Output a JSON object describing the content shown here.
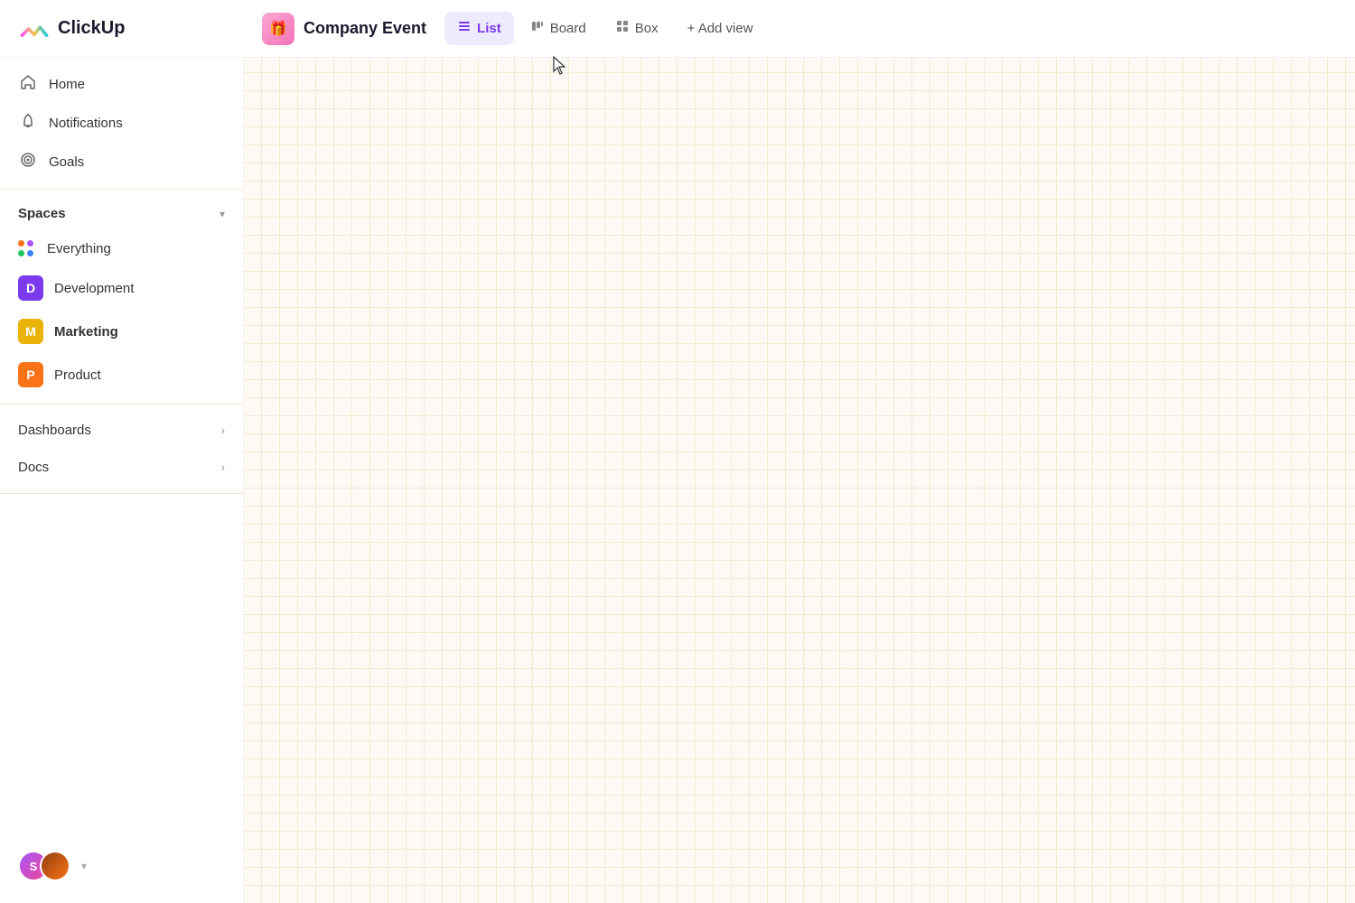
{
  "logo": {
    "text": "ClickUp"
  },
  "header": {
    "space_icon": "🎁",
    "space_name": "Company Event",
    "views": [
      {
        "id": "list",
        "label": "List",
        "icon": "≡",
        "active": true
      },
      {
        "id": "board",
        "label": "Board",
        "icon": "▦",
        "active": false
      },
      {
        "id": "box",
        "label": "Box",
        "icon": "⊞",
        "active": false
      }
    ],
    "add_view_label": "+ Add view"
  },
  "sidebar": {
    "nav_items": [
      {
        "id": "home",
        "label": "Home",
        "icon": "⌂"
      },
      {
        "id": "notifications",
        "label": "Notifications",
        "icon": "🔔"
      },
      {
        "id": "goals",
        "label": "Goals",
        "icon": "🏆"
      }
    ],
    "spaces_section": {
      "label": "Spaces",
      "expanded": true,
      "items": [
        {
          "id": "everything",
          "label": "Everything",
          "type": "everything"
        },
        {
          "id": "development",
          "label": "Development",
          "type": "badge",
          "color": "#7c3aed",
          "letter": "D"
        },
        {
          "id": "marketing",
          "label": "Marketing",
          "type": "badge",
          "color": "#eab308",
          "letter": "M",
          "bold": true
        },
        {
          "id": "product",
          "label": "Product",
          "type": "badge",
          "color": "#f97316",
          "letter": "P"
        }
      ]
    },
    "dashboards": {
      "label": "Dashboards"
    },
    "docs": {
      "label": "Docs"
    },
    "avatar_chevron": "▾",
    "user_initial": "S"
  },
  "main": {
    "background_color": "#fdfaf5",
    "grid_color": "#f0e0c0"
  }
}
